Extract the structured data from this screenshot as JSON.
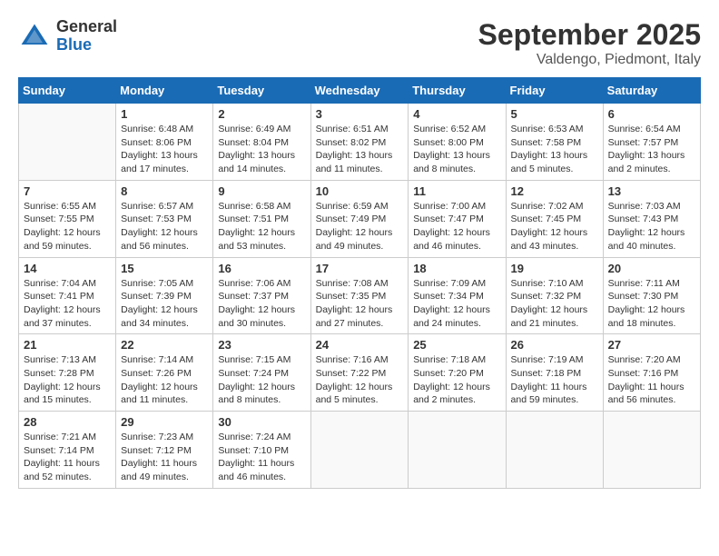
{
  "header": {
    "logo": {
      "general": "General",
      "blue": "Blue"
    },
    "title": "September 2025",
    "location": "Valdengo, Piedmont, Italy"
  },
  "weekdays": [
    "Sunday",
    "Monday",
    "Tuesday",
    "Wednesday",
    "Thursday",
    "Friday",
    "Saturday"
  ],
  "weeks": [
    [
      {
        "day": "",
        "empty": true
      },
      {
        "day": "1",
        "sunrise": "Sunrise: 6:48 AM",
        "sunset": "Sunset: 8:06 PM",
        "daylight": "Daylight: 13 hours and 17 minutes."
      },
      {
        "day": "2",
        "sunrise": "Sunrise: 6:49 AM",
        "sunset": "Sunset: 8:04 PM",
        "daylight": "Daylight: 13 hours and 14 minutes."
      },
      {
        "day": "3",
        "sunrise": "Sunrise: 6:51 AM",
        "sunset": "Sunset: 8:02 PM",
        "daylight": "Daylight: 13 hours and 11 minutes."
      },
      {
        "day": "4",
        "sunrise": "Sunrise: 6:52 AM",
        "sunset": "Sunset: 8:00 PM",
        "daylight": "Daylight: 13 hours and 8 minutes."
      },
      {
        "day": "5",
        "sunrise": "Sunrise: 6:53 AM",
        "sunset": "Sunset: 7:58 PM",
        "daylight": "Daylight: 13 hours and 5 minutes."
      },
      {
        "day": "6",
        "sunrise": "Sunrise: 6:54 AM",
        "sunset": "Sunset: 7:57 PM",
        "daylight": "Daylight: 13 hours and 2 minutes."
      }
    ],
    [
      {
        "day": "7",
        "sunrise": "Sunrise: 6:55 AM",
        "sunset": "Sunset: 7:55 PM",
        "daylight": "Daylight: 12 hours and 59 minutes."
      },
      {
        "day": "8",
        "sunrise": "Sunrise: 6:57 AM",
        "sunset": "Sunset: 7:53 PM",
        "daylight": "Daylight: 12 hours and 56 minutes."
      },
      {
        "day": "9",
        "sunrise": "Sunrise: 6:58 AM",
        "sunset": "Sunset: 7:51 PM",
        "daylight": "Daylight: 12 hours and 53 minutes."
      },
      {
        "day": "10",
        "sunrise": "Sunrise: 6:59 AM",
        "sunset": "Sunset: 7:49 PM",
        "daylight": "Daylight: 12 hours and 49 minutes."
      },
      {
        "day": "11",
        "sunrise": "Sunrise: 7:00 AM",
        "sunset": "Sunset: 7:47 PM",
        "daylight": "Daylight: 12 hours and 46 minutes."
      },
      {
        "day": "12",
        "sunrise": "Sunrise: 7:02 AM",
        "sunset": "Sunset: 7:45 PM",
        "daylight": "Daylight: 12 hours and 43 minutes."
      },
      {
        "day": "13",
        "sunrise": "Sunrise: 7:03 AM",
        "sunset": "Sunset: 7:43 PM",
        "daylight": "Daylight: 12 hours and 40 minutes."
      }
    ],
    [
      {
        "day": "14",
        "sunrise": "Sunrise: 7:04 AM",
        "sunset": "Sunset: 7:41 PM",
        "daylight": "Daylight: 12 hours and 37 minutes."
      },
      {
        "day": "15",
        "sunrise": "Sunrise: 7:05 AM",
        "sunset": "Sunset: 7:39 PM",
        "daylight": "Daylight: 12 hours and 34 minutes."
      },
      {
        "day": "16",
        "sunrise": "Sunrise: 7:06 AM",
        "sunset": "Sunset: 7:37 PM",
        "daylight": "Daylight: 12 hours and 30 minutes."
      },
      {
        "day": "17",
        "sunrise": "Sunrise: 7:08 AM",
        "sunset": "Sunset: 7:35 PM",
        "daylight": "Daylight: 12 hours and 27 minutes."
      },
      {
        "day": "18",
        "sunrise": "Sunrise: 7:09 AM",
        "sunset": "Sunset: 7:34 PM",
        "daylight": "Daylight: 12 hours and 24 minutes."
      },
      {
        "day": "19",
        "sunrise": "Sunrise: 7:10 AM",
        "sunset": "Sunset: 7:32 PM",
        "daylight": "Daylight: 12 hours and 21 minutes."
      },
      {
        "day": "20",
        "sunrise": "Sunrise: 7:11 AM",
        "sunset": "Sunset: 7:30 PM",
        "daylight": "Daylight: 12 hours and 18 minutes."
      }
    ],
    [
      {
        "day": "21",
        "sunrise": "Sunrise: 7:13 AM",
        "sunset": "Sunset: 7:28 PM",
        "daylight": "Daylight: 12 hours and 15 minutes."
      },
      {
        "day": "22",
        "sunrise": "Sunrise: 7:14 AM",
        "sunset": "Sunset: 7:26 PM",
        "daylight": "Daylight: 12 hours and 11 minutes."
      },
      {
        "day": "23",
        "sunrise": "Sunrise: 7:15 AM",
        "sunset": "Sunset: 7:24 PM",
        "daylight": "Daylight: 12 hours and 8 minutes."
      },
      {
        "day": "24",
        "sunrise": "Sunrise: 7:16 AM",
        "sunset": "Sunset: 7:22 PM",
        "daylight": "Daylight: 12 hours and 5 minutes."
      },
      {
        "day": "25",
        "sunrise": "Sunrise: 7:18 AM",
        "sunset": "Sunset: 7:20 PM",
        "daylight": "Daylight: 12 hours and 2 minutes."
      },
      {
        "day": "26",
        "sunrise": "Sunrise: 7:19 AM",
        "sunset": "Sunset: 7:18 PM",
        "daylight": "Daylight: 11 hours and 59 minutes."
      },
      {
        "day": "27",
        "sunrise": "Sunrise: 7:20 AM",
        "sunset": "Sunset: 7:16 PM",
        "daylight": "Daylight: 11 hours and 56 minutes."
      }
    ],
    [
      {
        "day": "28",
        "sunrise": "Sunrise: 7:21 AM",
        "sunset": "Sunset: 7:14 PM",
        "daylight": "Daylight: 11 hours and 52 minutes."
      },
      {
        "day": "29",
        "sunrise": "Sunrise: 7:23 AM",
        "sunset": "Sunset: 7:12 PM",
        "daylight": "Daylight: 11 hours and 49 minutes."
      },
      {
        "day": "30",
        "sunrise": "Sunrise: 7:24 AM",
        "sunset": "Sunset: 7:10 PM",
        "daylight": "Daylight: 11 hours and 46 minutes."
      },
      {
        "day": "",
        "empty": true
      },
      {
        "day": "",
        "empty": true
      },
      {
        "day": "",
        "empty": true
      },
      {
        "day": "",
        "empty": true
      }
    ]
  ]
}
